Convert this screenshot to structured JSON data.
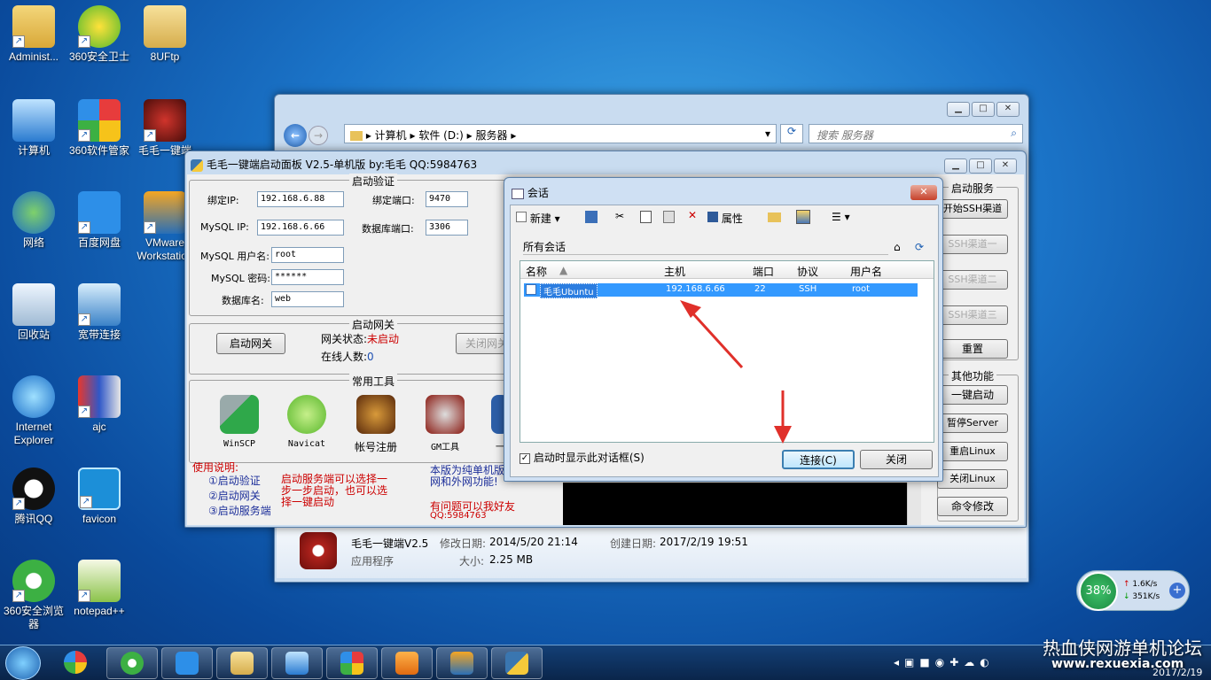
{
  "desktop": {
    "icons": [
      {
        "label": "Administ...",
        "icon": "user-folder-icon"
      },
      {
        "label": "360安全卫士",
        "icon": "360-safe-icon"
      },
      {
        "label": "8UFtp",
        "icon": "folder-icon"
      },
      {
        "label": "计算机",
        "icon": "computer-icon"
      },
      {
        "label": "360软件管家",
        "icon": "360-software-icon"
      },
      {
        "label": "毛毛一键端",
        "icon": "dragon-icon"
      },
      {
        "label": "网络",
        "icon": "network-icon"
      },
      {
        "label": "百度网盘",
        "icon": "baidu-cloud-icon"
      },
      {
        "label": "VMware Workstation",
        "icon": "vmware-icon"
      },
      {
        "label": "回收站",
        "icon": "recycle-bin-icon"
      },
      {
        "label": "宽带连接",
        "icon": "broadband-icon"
      },
      {
        "label": "Internet Explorer",
        "icon": "ie-icon"
      },
      {
        "label": "ajc",
        "icon": "archive-icon"
      },
      {
        "label": "腾讯QQ",
        "icon": "qq-icon"
      },
      {
        "label": "favicon",
        "icon": "favicon-icon"
      },
      {
        "label": "360安全浏览器",
        "icon": "360-browser-icon"
      },
      {
        "label": "notepad++",
        "icon": "notepadpp-icon"
      }
    ]
  },
  "explorer": {
    "breadcrumb": [
      "计算机",
      "软件 (D:)",
      "服务器"
    ],
    "search_placeholder": "搜索 服务器",
    "details": {
      "name": "毛毛一键端V2.5",
      "type": "应用程序",
      "modified_label": "修改日期:",
      "modified": "2014/5/20 21:14",
      "created_label": "创建日期:",
      "created": "2017/2/19 19:51",
      "size_label": "大小:",
      "size": "2.25 MB"
    }
  },
  "panel": {
    "title": "毛毛一键端启动面板 V2.5-单机版 by:毛毛  QQ:5984763",
    "auth": {
      "group": "启动验证",
      "bind_ip_label": "绑定IP:",
      "bind_ip": "192.168.6.88",
      "bind_port_label": "绑定端口:",
      "bind_port": "9470",
      "mysql_ip_label": "MySQL IP:",
      "mysql_ip": "192.168.6.66",
      "db_port_label": "数据库端口:",
      "db_port": "3306",
      "mysql_user_label": "MySQL 用户名:",
      "mysql_user": "root",
      "mysql_pass_label": "MySQL 密码:",
      "mysql_pass": "******",
      "db_name_label": "数据库名:",
      "db_name": "web"
    },
    "gateway": {
      "group": "启动网关",
      "start_btn": "启动网关",
      "status_label": "网关状态:",
      "status": "未启动",
      "online_label": "在线人数:",
      "online": "0",
      "close_btn": "关闭网关"
    },
    "tools": {
      "group": "常用工具",
      "items": [
        "WinSCP",
        "Navicat",
        "帐号注册",
        "GM工具",
        "一"
      ]
    },
    "usage": {
      "title": "使用说明:",
      "steps": [
        "①启动验证",
        "②启动网关",
        "③启动服务端"
      ],
      "note": "启动服务端可以选择一步一步启动，也可以选择一键启动",
      "edition": "本版为纯单机版",
      "edition2": "网和外网功能!",
      "contact": "有问题可以我好友",
      "qq": "QQ:5984763"
    },
    "right": {
      "start_group": "启动服务",
      "btn_ssh": "开始SSH渠道",
      "btn_ssh1": "SSH渠道一",
      "btn_ssh2": "SSH渠道二",
      "btn_ssh3": "SSH渠道三",
      "btn_reset": "重置",
      "other_group": "其他功能",
      "btn_onekey": "一键启动",
      "btn_pause": "暂停Server",
      "btn_reboot": "重启Linux",
      "btn_shutdown": "关闭Linux",
      "btn_cmd": "命令修改"
    }
  },
  "session_dialog": {
    "title": "会话",
    "toolbar": {
      "new": "新建",
      "properties": "属性"
    },
    "path": "所有会话",
    "columns": [
      "名称",
      "主机",
      "端口",
      "协议",
      "用户名"
    ],
    "rows": [
      {
        "name": "毛毛Ubuntu",
        "host": "192.168.6.66",
        "port": "22",
        "protocol": "SSH",
        "user": "root"
      }
    ],
    "startup_checkbox": "启动时显示此对话框(S)",
    "connect_btn": "连接(C)",
    "close_btn": "关闭"
  },
  "tray": {
    "percent": "38%",
    "up": "1.6K/s",
    "down": "351K/s"
  },
  "watermark": "热血侠网游单机论坛",
  "watermark_url": "www.rexuexia.com",
  "clock_date": "2017/2/19",
  "colors": {
    "accent": "#3399ff",
    "selection": "#3399ff",
    "warning": "#cc0000"
  }
}
